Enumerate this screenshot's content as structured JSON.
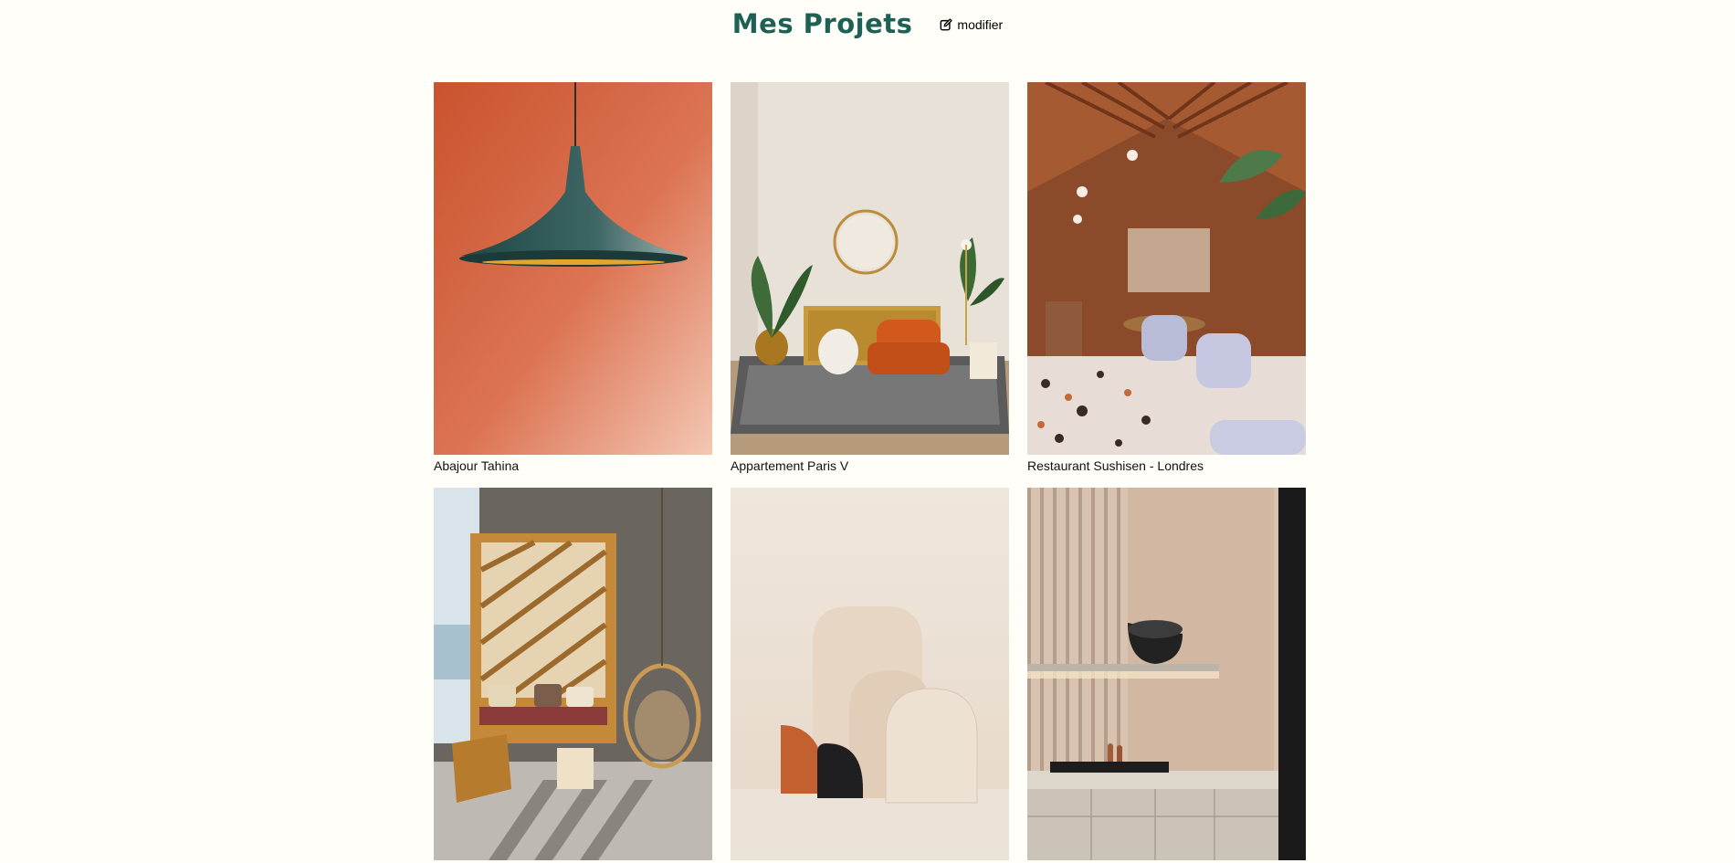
{
  "header": {
    "title": "Mes Projets",
    "edit_label": "modifier",
    "edit_icon": "pen-to-square-icon",
    "title_color": "#1d6154"
  },
  "gallery": {
    "items": [
      {
        "caption": "Abajour Tahina",
        "image": "pendant-lamp-photo"
      },
      {
        "caption": "Appartement Paris V",
        "image": "living-room-photo"
      },
      {
        "caption": "Restaurant Sushisen - Londres",
        "image": "restaurant-interior-photo"
      },
      {
        "caption": "",
        "image": "sunroom-swing-chair-photo"
      },
      {
        "caption": "",
        "image": "arched-panels-photo"
      },
      {
        "caption": "",
        "image": "kitchen-lamp-photo"
      }
    ]
  }
}
